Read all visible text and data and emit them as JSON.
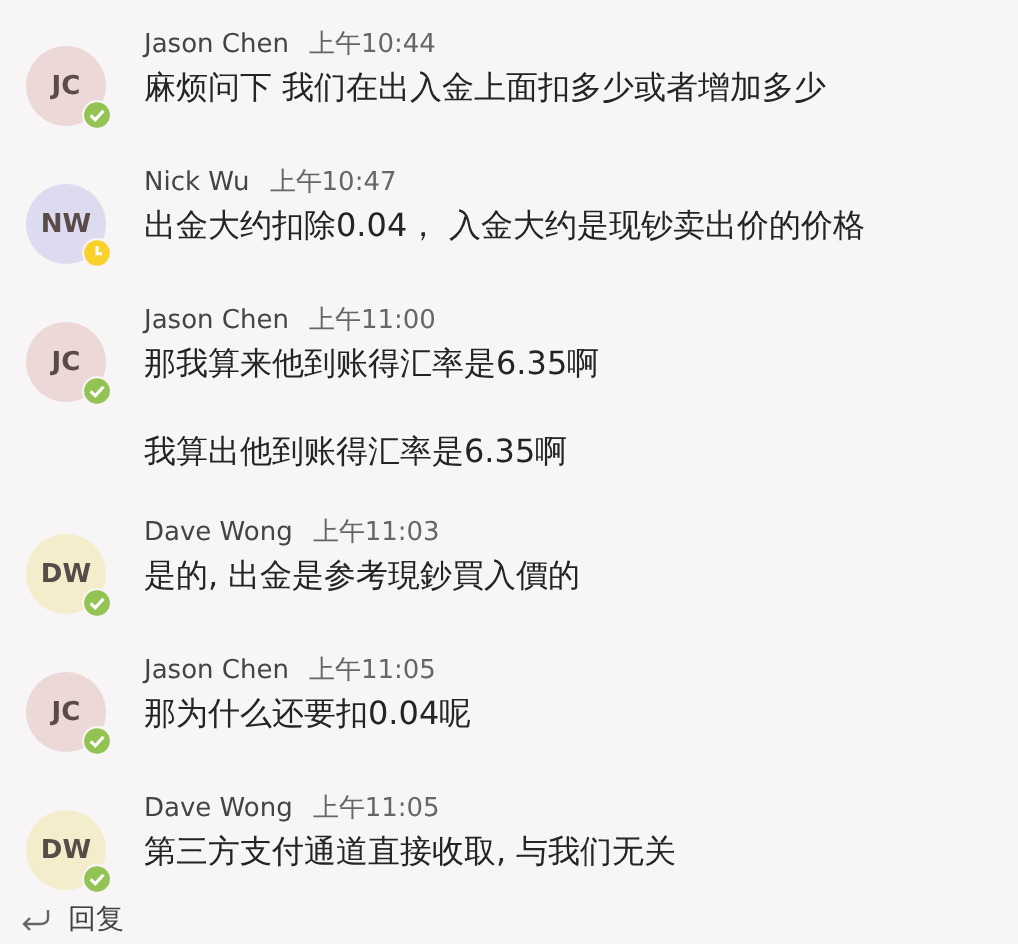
{
  "messages": [
    {
      "initials": "JC",
      "color": "#ecd8d6",
      "away": false,
      "name": "Jason Chen",
      "time": "上午10:44",
      "texts": [
        "麻烦问下 我们在出入金上面扣多少或者增加多少"
      ]
    },
    {
      "initials": "NW",
      "color": "#dcdbef",
      "away": true,
      "name": "Nick Wu",
      "time": "上午10:47",
      "texts": [
        "出金大约扣除0.04， 入金大约是现钞卖出价的价格"
      ]
    },
    {
      "initials": "JC",
      "color": "#ecd8d6",
      "away": false,
      "name": "Jason Chen",
      "time": "上午11:00",
      "texts": [
        "那我算来他到账得汇率是6.35啊",
        "我算出他到账得汇率是6.35啊"
      ]
    },
    {
      "initials": "DW",
      "color": "#f3edcb",
      "away": false,
      "name": "Dave Wong",
      "time": "上午11:03",
      "texts": [
        "是的, 出金是参考現鈔買入價的"
      ]
    },
    {
      "initials": "JC",
      "color": "#ecd8d6",
      "away": false,
      "name": "Jason Chen",
      "time": "上午11:05",
      "texts": [
        "那为什么还要扣0.04呢"
      ]
    },
    {
      "initials": "DW",
      "color": "#f3edcb",
      "away": false,
      "name": "Dave Wong",
      "time": "上午11:05",
      "texts": [
        "第三方支付通道直接收取, 与我们无关"
      ]
    }
  ],
  "reply": {
    "label": "回复"
  }
}
